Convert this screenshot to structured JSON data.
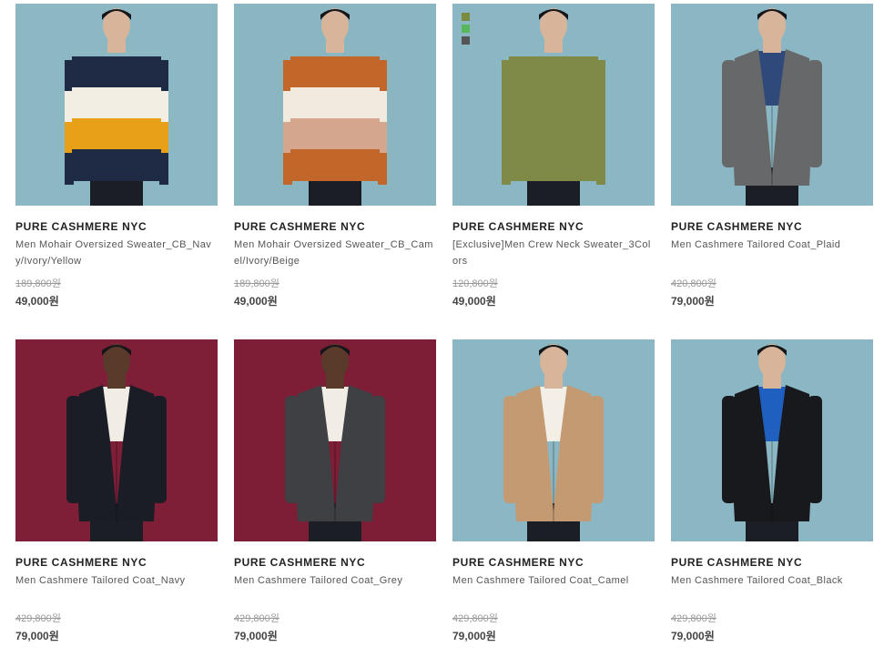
{
  "colors": {
    "bg_blue": "#8bb7c3",
    "bg_maroon": "#7e1e37",
    "brand_text": "#222222",
    "price_strike": "#999999"
  },
  "products": [
    {
      "brand": "PURE CASHMERE NYC",
      "name": "Men Mohair Oversized Sweater_CB_Navy/Ivory/Yellow",
      "original_price": "189,800원",
      "sale_price": "49,000원",
      "photo_bg": "#8cb8c4",
      "garment": "sweater",
      "stripes": [
        "#1f2a44",
        "#f3eee3",
        "#e8a018",
        "#1f2a44"
      ]
    },
    {
      "brand": "PURE CASHMERE NYC",
      "name": "Men Mohair Oversized Sweater_CB_Camel/Ivory/Beige",
      "original_price": "189,800원",
      "sale_price": "49,000원",
      "photo_bg": "#8ab6c2",
      "garment": "sweater",
      "stripes": [
        "#c3662a",
        "#f1ebdf",
        "#d4a68d",
        "#c3662a"
      ]
    },
    {
      "brand": "PURE CASHMERE NYC",
      "name": "[Exclusive]Men Crew Neck Sweater_3Colors",
      "original_price": "120,800원",
      "sale_price": "49,000원",
      "photo_bg": "#8ab7c3",
      "garment": "sweater",
      "stripes": [
        "#7f8a46",
        "#7f8a46",
        "#7f8a46",
        "#7f8a46"
      ],
      "swatches": [
        "#7a8a3e",
        "#57b85a",
        "#555555"
      ]
    },
    {
      "brand": "PURE CASHMERE NYC",
      "name": "Men Cashmere Tailored Coat_Plaid",
      "original_price": "420,800원",
      "sale_price": "79,000원",
      "photo_bg": "#8ab7c3",
      "garment": "coat",
      "coat": "#66686a",
      "inner": "#2f4a7a"
    },
    {
      "brand": "PURE CASHMERE NYC",
      "name": "Men Cashmere Tailored Coat_Navy",
      "original_price": "429,800원",
      "sale_price": "79,000원",
      "photo_bg": "#7e1e37",
      "garment": "coat",
      "coat": "#1b1d26",
      "inner": "#f1ece4"
    },
    {
      "brand": "PURE CASHMERE NYC",
      "name": "Men Cashmere Tailored Coat_Grey",
      "original_price": "429,800원",
      "sale_price": "79,000원",
      "photo_bg": "#7d1d36",
      "garment": "coat",
      "coat": "#3e4044",
      "inner": "#f1ece4"
    },
    {
      "brand": "PURE CASHMERE NYC",
      "name": "Men Cashmere Tailored Coat_Camel",
      "original_price": "429,800원",
      "sale_price": "79,000원",
      "photo_bg": "#8ab7c3",
      "garment": "coat",
      "coat": "#c49a72",
      "inner": "#f4efe6"
    },
    {
      "brand": "PURE CASHMERE NYC",
      "name": "Men Cashmere Tailored Coat_Black",
      "original_price": "429,800원",
      "sale_price": "79,000원",
      "photo_bg": "#8ab7c3",
      "garment": "coat",
      "coat": "#18191d",
      "inner": "#1f5fc0"
    }
  ]
}
